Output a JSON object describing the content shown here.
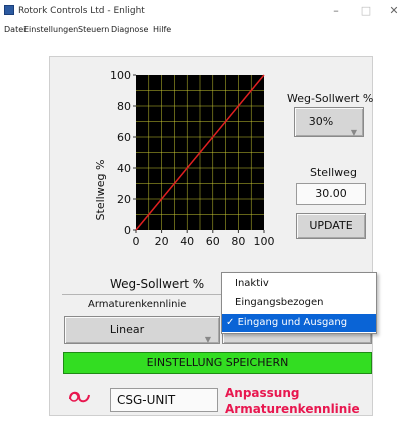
{
  "window": {
    "title": "Rotork Controls Ltd - Enlight",
    "minimize": "–",
    "maximize": "□",
    "close": "✕"
  },
  "menu": [
    "Datei",
    "Einstellungen",
    "Steuern",
    "Diagnose",
    "Hilfe"
  ],
  "chart_data": {
    "type": "line",
    "ylabel": "Stellweg %",
    "x_ticks": [
      "0",
      "20",
      "40",
      "60",
      "80",
      "100"
    ],
    "y_ticks": [
      "0",
      "20",
      "40",
      "60",
      "80",
      "100"
    ],
    "xlim": [
      0,
      100
    ],
    "ylim": [
      0,
      100
    ],
    "grid": true,
    "background": "#000000",
    "grid_color": "#c8c832",
    "series": [
      {
        "x": [
          0,
          100
        ],
        "y": [
          0,
          100
        ],
        "color": "#e02020"
      }
    ]
  },
  "right": {
    "setpoint_label": "Weg-Sollwert %",
    "setpoint_value": "30%",
    "travel_label": "Stellweg",
    "travel_value": "30.00",
    "update_label": "UPDATE"
  },
  "lower": {
    "setpoint_tab": "Weg-Sollwert %",
    "curve_label": "Armaturenkennlinie",
    "curve_value": "Linear"
  },
  "dropdown": {
    "options": [
      "Inaktiv",
      "Eingangsbezogen",
      "Eingang und Ausgang"
    ],
    "selected_index": 2,
    "check": "✓"
  },
  "save_label": "EINSTELLUNG SPEICHERN",
  "footer": {
    "unit_value": "CSG-UNIT",
    "title_line1": "Anpassung",
    "title_line2": "Armaturenkennlinie"
  },
  "colors": {
    "save_bar": "#33dd22",
    "accent_red": "#e8174f",
    "selection": "#0a64d6"
  }
}
